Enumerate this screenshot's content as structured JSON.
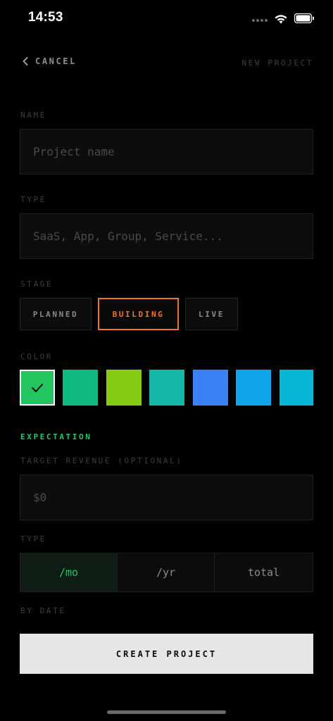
{
  "status_bar": {
    "time": "14:53"
  },
  "header": {
    "cancel_label": "CANCEL",
    "title": "NEW PROJECT"
  },
  "name": {
    "label": "NAME",
    "placeholder": "Project name",
    "value": ""
  },
  "type": {
    "label": "TYPE",
    "placeholder": "SaaS, App, Group, Service...",
    "value": ""
  },
  "stage": {
    "label": "STAGE",
    "options": [
      "PLANNED",
      "BUILDING",
      "LIVE"
    ],
    "selected": "BUILDING"
  },
  "color": {
    "label": "COLOR",
    "swatches": [
      "#22c55e",
      "#10b981",
      "#84cc16",
      "#14b8a6",
      "#3b82f6",
      "#0ea5e9",
      "#06b6d4"
    ],
    "selected_index": 0
  },
  "expectation": {
    "section_label": "EXPECTATION",
    "target_label": "TARGET REVENUE (OPTIONAL)",
    "target_placeholder": "$0",
    "type_label": "TYPE",
    "type_options": [
      "/mo",
      "/yr",
      "total"
    ],
    "type_selected": "/mo",
    "by_date_label": "BY DATE"
  },
  "create_button": "CREATE PROJECT",
  "colors": {
    "accent_stage": "#f0742b",
    "accent_green": "#26c46a",
    "background": "#000000"
  }
}
